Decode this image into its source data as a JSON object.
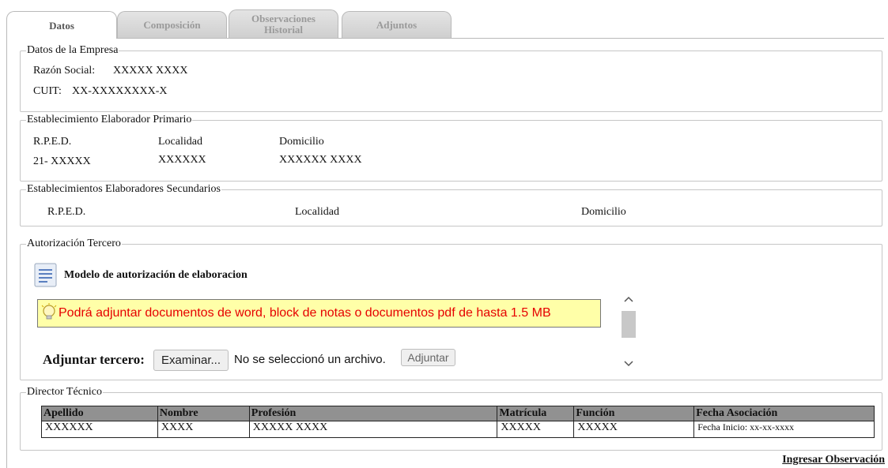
{
  "tabs": [
    {
      "label": "Datos"
    },
    {
      "label1": "Composición"
    },
    {
      "label1": "Observaciones",
      "label2": "Historial"
    },
    {
      "label1": "Adjuntos"
    }
  ],
  "empresa": {
    "legend": "Datos de la Empresa",
    "razon_label": "Razón Social:",
    "razon_value": "XXXXX XXXX",
    "cuit_label": "CUIT:",
    "cuit_value": "XX-XXXXXXXX-X"
  },
  "primario": {
    "legend": "Establecimiento Elaborador Primario",
    "headers": [
      "R.P.E.D.",
      "Localidad",
      "Domicilio"
    ],
    "values": [
      "21- XXXXX",
      "XXXXXX",
      "XXXXXX XXXX"
    ]
  },
  "secundarios": {
    "legend": "Establecimientos Elaboradores Secundarios",
    "headers": [
      "R.P.E.D.",
      "Localidad",
      "Domicilio"
    ]
  },
  "autorizacion": {
    "legend": "Autorización Tercero",
    "model_link": "Modelo de autorización de elaboracion",
    "tip": "Podrá adjuntar documentos de word, block de notas o documentos pdf de hasta 1.5 MB",
    "adjuntar_label": "Adjuntar tercero:",
    "browse_button": "Examinar...",
    "no_file": "No se seleccionó un archivo.",
    "attach_button": "Adjuntar"
  },
  "director": {
    "legend": "Director Técnico",
    "columns": [
      "Apellido",
      "Nombre",
      "Profesión",
      "Matrícula",
      "Función",
      "Fecha Asociación"
    ],
    "row": [
      "XXXXXX",
      "XXXX",
      "XXXXX XXXX",
      "XXXXX",
      "XXXXX",
      "Fecha Inicio: xx-xx-xxxx"
    ]
  },
  "footer": {
    "link": "Ingresar Observación"
  }
}
